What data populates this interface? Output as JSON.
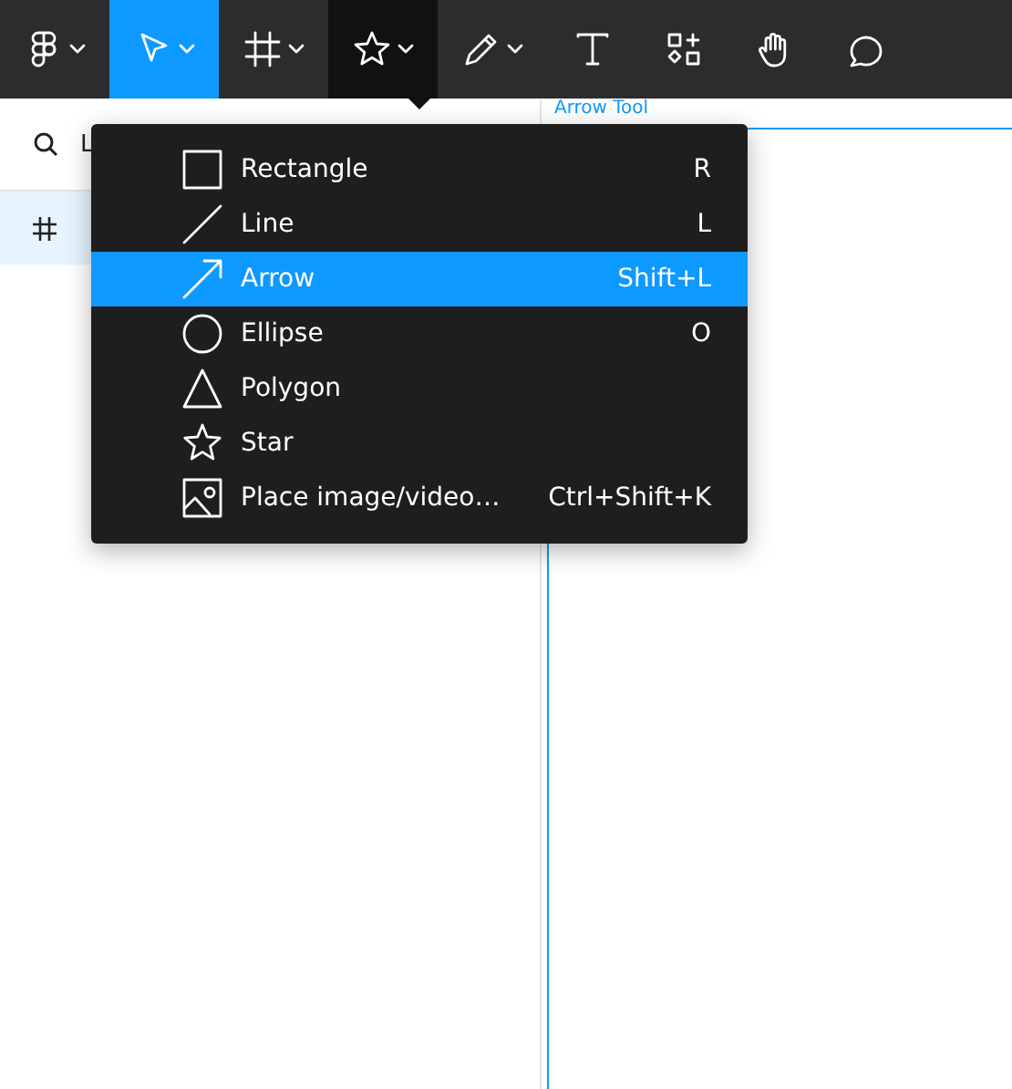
{
  "toolbar": {
    "tools": [
      {
        "kind": "logo",
        "selected": false,
        "open": false,
        "dropdown": true
      },
      {
        "kind": "move",
        "selected": true,
        "open": false,
        "dropdown": true
      },
      {
        "kind": "frame",
        "selected": false,
        "open": false,
        "dropdown": true
      },
      {
        "kind": "shape",
        "selected": false,
        "open": true,
        "dropdown": true
      },
      {
        "kind": "pen",
        "selected": false,
        "open": false,
        "dropdown": true
      },
      {
        "kind": "text",
        "selected": false,
        "open": false,
        "dropdown": false
      },
      {
        "kind": "resources",
        "selected": false,
        "open": false,
        "dropdown": false
      },
      {
        "kind": "hand",
        "selected": false,
        "open": false,
        "dropdown": false
      },
      {
        "kind": "comment",
        "selected": false,
        "open": false,
        "dropdown": false
      }
    ]
  },
  "layers_panel": {
    "search": {
      "value": "L"
    },
    "layers": [
      {
        "selected": true
      }
    ]
  },
  "canvas": {
    "frame_label": "Arrow Tool"
  },
  "shape_menu": {
    "items": [
      {
        "kind": "rectangle",
        "label": "Rectangle",
        "shortcut": "R",
        "selected": false
      },
      {
        "kind": "line",
        "label": "Line",
        "shortcut": "L",
        "selected": false
      },
      {
        "kind": "arrow",
        "label": "Arrow",
        "shortcut": "Shift+L",
        "selected": true
      },
      {
        "kind": "ellipse",
        "label": "Ellipse",
        "shortcut": "O",
        "selected": false
      },
      {
        "kind": "polygon",
        "label": "Polygon",
        "selected": false
      },
      {
        "kind": "star",
        "label": "Star",
        "selected": false
      },
      {
        "kind": "image",
        "label": "Place image/video…",
        "shortcut": "Ctrl+Shift+K",
        "selected": false
      }
    ]
  }
}
